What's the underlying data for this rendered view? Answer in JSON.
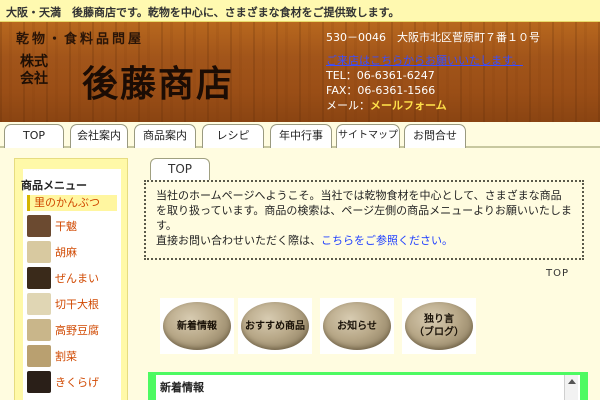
{
  "topbar": {
    "text": "大阪・天満　後藤商店です。乾物を中心に、さまざまな食材をご提供致します。"
  },
  "header": {
    "tagline": "乾物・食料品問屋",
    "kabushiki_line1": "株式",
    "kabushiki_line2": "会社",
    "brand": "後藤商店",
    "postal": "530－0046　大阪市北区菅原町７番１０号",
    "guide_link": "ご来店はこちらからお願いいたします。",
    "tel": "TEL：06-6361-6247",
    "fax": "FAX：06-6361-1566",
    "mail_label": "メール：",
    "mail_link": "メールフォーム"
  },
  "tabs": [
    {
      "label": "TOP"
    },
    {
      "label": "会社案内"
    },
    {
      "label": "商品案内"
    },
    {
      "label": "レシピ"
    },
    {
      "label": "年中行事"
    },
    {
      "label": "サイトマップ"
    },
    {
      "label": "お問合せ"
    }
  ],
  "sidebar": {
    "title": "商品メニュー",
    "first_item": "里のかんぶつ",
    "items": [
      {
        "label": "干魃",
        "icon": "dried-goods-thumb",
        "color": "#6b4a30"
      },
      {
        "label": "胡麻",
        "icon": "sesame-thumb",
        "color": "#d8c9a0"
      },
      {
        "label": "ぜんまい",
        "icon": "zenmai-thumb",
        "color": "#3a2a1a"
      },
      {
        "label": "切干大根",
        "icon": "kiriboshi-thumb",
        "color": "#e0d6b4"
      },
      {
        "label": "高野豆腐",
        "icon": "koya-tofu-thumb",
        "color": "#c9b68a"
      },
      {
        "label": "割菜",
        "icon": "warina-thumb",
        "color": "#b9a070"
      },
      {
        "label": "きくらげ",
        "icon": "kikurage-thumb",
        "color": "#2a1f18"
      }
    ]
  },
  "main": {
    "tab_label": "TOP",
    "welcome_text": "当社のホームページへようこそ。当社では乾物食材を中心として、さまざまな商品を取り扱っています。商品の検索は、ページ左側の商品メニューよりお願いいたします。",
    "welcome_contact": "直接お問い合わせいただく際は、",
    "welcome_link": "こちらをご参照ください。",
    "top_link": "TOP",
    "pebbles": [
      {
        "label": "新着情報"
      },
      {
        "label": "おすすめ商品"
      },
      {
        "label": "お知らせ"
      },
      {
        "label": "独り言\n（ブログ）"
      }
    ],
    "news_title": "新着情報"
  }
}
